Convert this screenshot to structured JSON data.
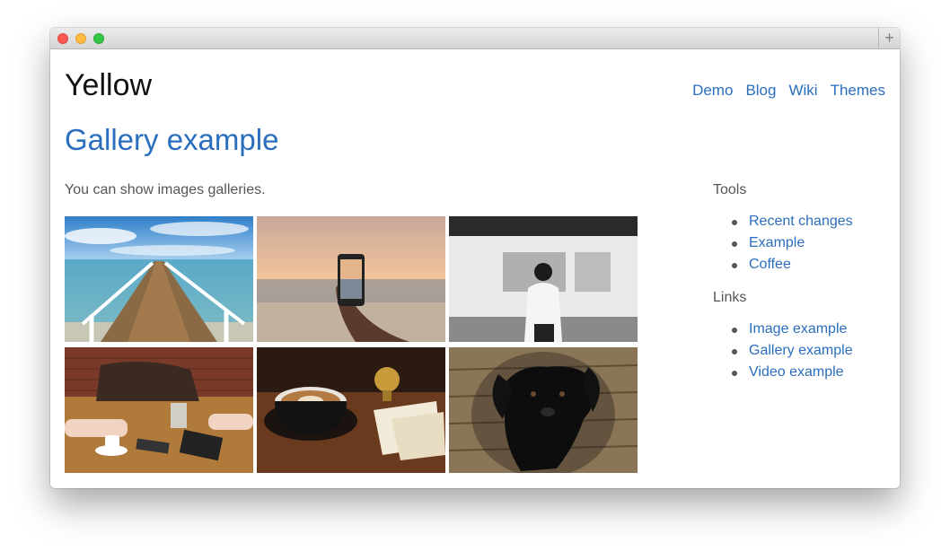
{
  "site": {
    "title": "Yellow"
  },
  "nav": [
    {
      "label": "Demo"
    },
    {
      "label": "Blog"
    },
    {
      "label": "Wiki"
    },
    {
      "label": "Themes"
    }
  ],
  "page": {
    "title": "Gallery example",
    "intro": "You can show images galleries."
  },
  "gallery": {
    "images": [
      {
        "name": "pier-photo",
        "alt": ""
      },
      {
        "name": "phone-sunset-photo",
        "alt": ""
      },
      {
        "name": "train-platform-photo",
        "alt": ""
      },
      {
        "name": "cafe-table-photo",
        "alt": ""
      },
      {
        "name": "coffee-cup-photo",
        "alt": ""
      },
      {
        "name": "black-dog-photo",
        "alt": ""
      }
    ]
  },
  "sidebar": {
    "tools_heading": "Tools",
    "tools": [
      {
        "label": "Recent changes"
      },
      {
        "label": "Example"
      },
      {
        "label": "Coffee"
      }
    ],
    "links_heading": "Links",
    "links": [
      {
        "label": "Image example"
      },
      {
        "label": "Gallery example"
      },
      {
        "label": "Video example"
      }
    ]
  },
  "colors": {
    "link": "#2a6ebd",
    "text": "#555555",
    "title": "#111111"
  },
  "window": {
    "new_tab_label": "+"
  }
}
